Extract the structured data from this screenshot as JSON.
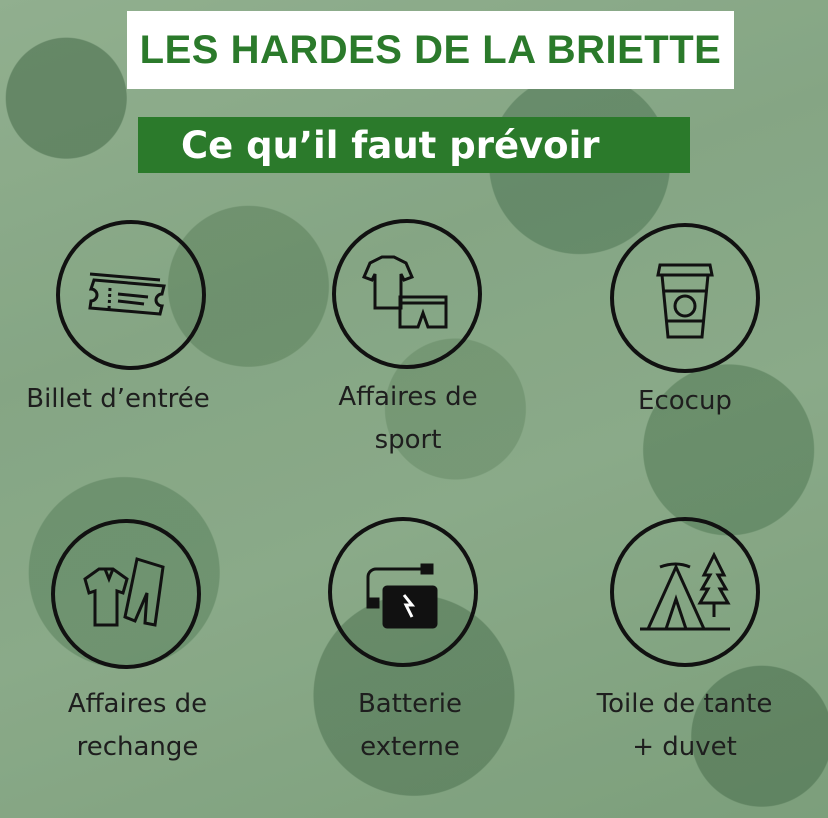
{
  "header": {
    "title": "LES HARDES DE LA BRIETTE",
    "subtitle": "Ce qu’il faut prévoir"
  },
  "items": [
    {
      "icon": "ticket-icon",
      "label_lines": [
        "Billet d’entrée"
      ]
    },
    {
      "icon": "sport-clothes-icon",
      "label_lines": [
        "Affaires de",
        "sport"
      ]
    },
    {
      "icon": "ecocup-icon",
      "label_lines": [
        "Ecocup"
      ]
    },
    {
      "icon": "spare-clothes-icon",
      "label_lines": [
        "Affaires de",
        "rechange"
      ]
    },
    {
      "icon": "power-bank-icon",
      "label_lines": [
        "Batterie",
        "externe"
      ]
    },
    {
      "icon": "tent-icon",
      "label_lines": [
        "Toile de tante",
        "+ duvet"
      ]
    }
  ],
  "colors": {
    "brand_green": "#2b7a2b",
    "icon_stroke": "#111111",
    "title_background": "#ffffff"
  }
}
